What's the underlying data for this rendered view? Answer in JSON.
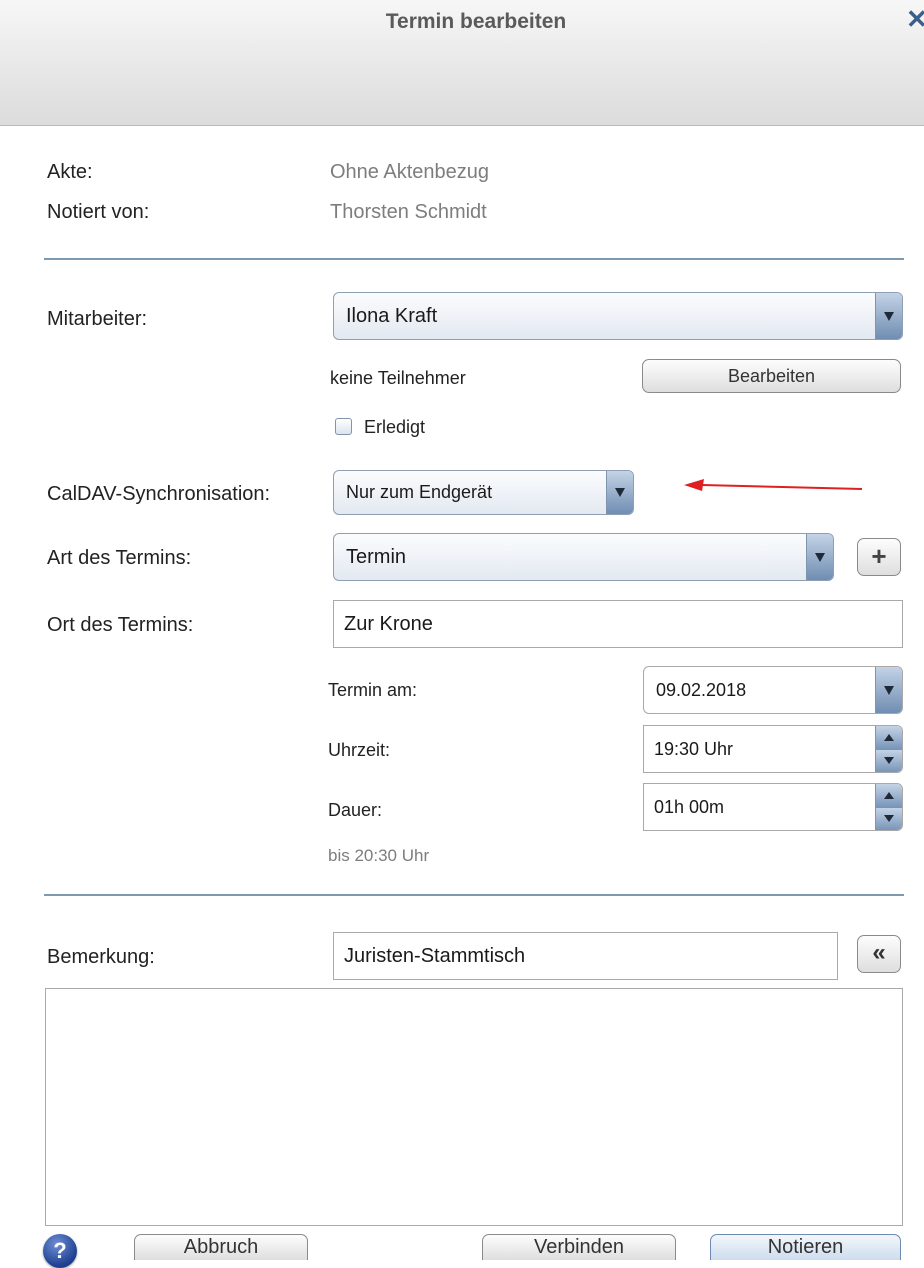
{
  "dialog": {
    "title": "Termin bearbeiten",
    "close_icon": "close-icon"
  },
  "info": {
    "akte_label": "Akte:",
    "akte_value": "Ohne Aktenbezug",
    "notiert_label": "Notiert von:",
    "notiert_value": "Thorsten Schmidt"
  },
  "mitarbeiter": {
    "label": "Mitarbeiter:",
    "value": "Ilona Kraft"
  },
  "teilnehmer": {
    "text": "keine Teilnehmer",
    "button": "Bearbeiten"
  },
  "erledigt": {
    "label": "Erledigt",
    "checked": false
  },
  "caldav": {
    "label": "CalDAV-Synchronisation:",
    "value": "Nur zum Endgerät",
    "annotation_arrow_color": "#e02020"
  },
  "art": {
    "label": "Art des Termins:",
    "value": "Termin",
    "add_icon": "plus-icon"
  },
  "ort": {
    "label": "Ort des Termins:",
    "value": "Zur Krone"
  },
  "datum": {
    "label": "Termin am:",
    "value": "09.02.2018"
  },
  "uhrzeit": {
    "label": "Uhrzeit:",
    "value": "19:30 Uhr"
  },
  "dauer": {
    "label": "Dauer:",
    "value": "01h 00m",
    "bis": "bis 20:30 Uhr"
  },
  "bemerkung": {
    "label": "Bemerkung:",
    "value": "Juristen-Stammtisch",
    "collapse_icon": "double-chevron-left-icon",
    "text": ""
  },
  "footer": {
    "help_label": "?",
    "abbruch": "Abbruch",
    "verbinden": "Verbinden",
    "notieren": "Notieren"
  },
  "colors": {
    "accent": "#3a5f8c",
    "separator": "#7d9ab3"
  }
}
